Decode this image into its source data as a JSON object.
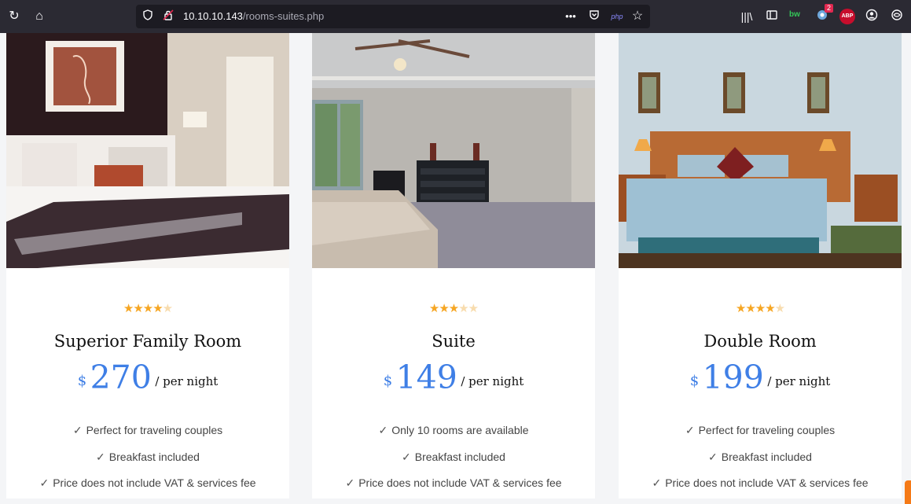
{
  "browser": {
    "url_host": "10.10.10.143",
    "url_path": "/rooms-suites.php",
    "extension_badge": "2",
    "bw_label": "bw",
    "abp_label": "ABP",
    "php_label": "php"
  },
  "rooms": [
    {
      "name": "Superior Family Room",
      "currency": "$",
      "price": "270",
      "per": "/ per night",
      "rating": 4,
      "max_rating": 5,
      "features": [
        "Perfect for traveling couples",
        "Breakfast included",
        "Price does not include VAT & services fee"
      ]
    },
    {
      "name": "Suite",
      "currency": "$",
      "price": "149",
      "per": "/ per night",
      "rating": 3,
      "max_rating": 5,
      "features": [
        "Only 10 rooms are available",
        "Breakfast included",
        "Price does not include VAT & services fee"
      ]
    },
    {
      "name": "Double Room",
      "currency": "$",
      "price": "199",
      "per": "/ per night",
      "rating": 4,
      "max_rating": 5,
      "features": [
        "Perfect for traveling couples",
        "Breakfast included",
        "Price does not include VAT & services fee"
      ]
    }
  ],
  "colors": {
    "accent": "#3f7fe6",
    "star": "#f6a623",
    "toolbar": "#2b2a33"
  }
}
